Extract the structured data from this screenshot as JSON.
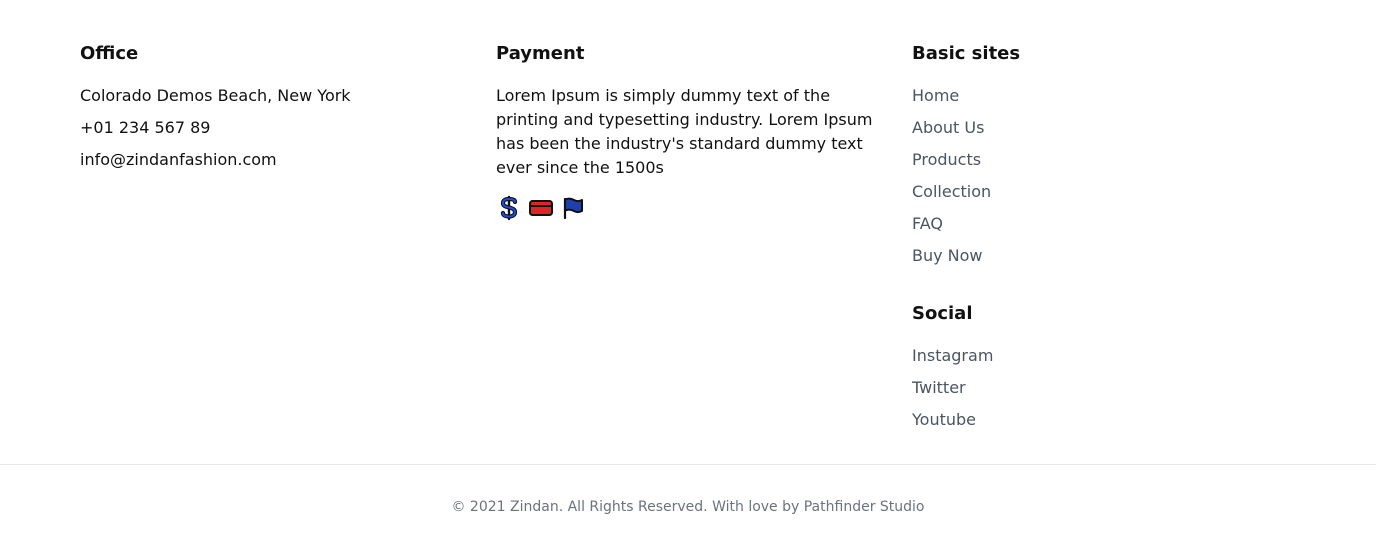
{
  "office": {
    "heading": "Office",
    "address": "Colorado Demos Beach, New York",
    "phone": "+01 234 567 89",
    "email": "info@zindanfashion.com"
  },
  "payment": {
    "heading": "Payment",
    "description": "Lorem Ipsum is simply dummy text of the printing and typesetting industry. Lorem Ipsum has been the industry's standard dummy text ever since the 1500s",
    "icons": [
      "dollar-icon",
      "credit-card-icon",
      "flag-icon"
    ],
    "icon_colors": {
      "dollar": "#1d4ed8",
      "card": "#dc2626",
      "flag": "#1e40af",
      "outline": "#111111"
    }
  },
  "basic_sites": {
    "heading": "Basic sites",
    "links": [
      "Home",
      "About Us",
      "Products",
      "Collection",
      "FAQ",
      "Buy Now"
    ]
  },
  "social": {
    "heading": "Social",
    "links": [
      "Instagram",
      "Twitter",
      "Youtube"
    ]
  },
  "footer": {
    "copyright": "© 2021 Zindan. All Rights Reserved. With love by Pathfinder Studio"
  }
}
